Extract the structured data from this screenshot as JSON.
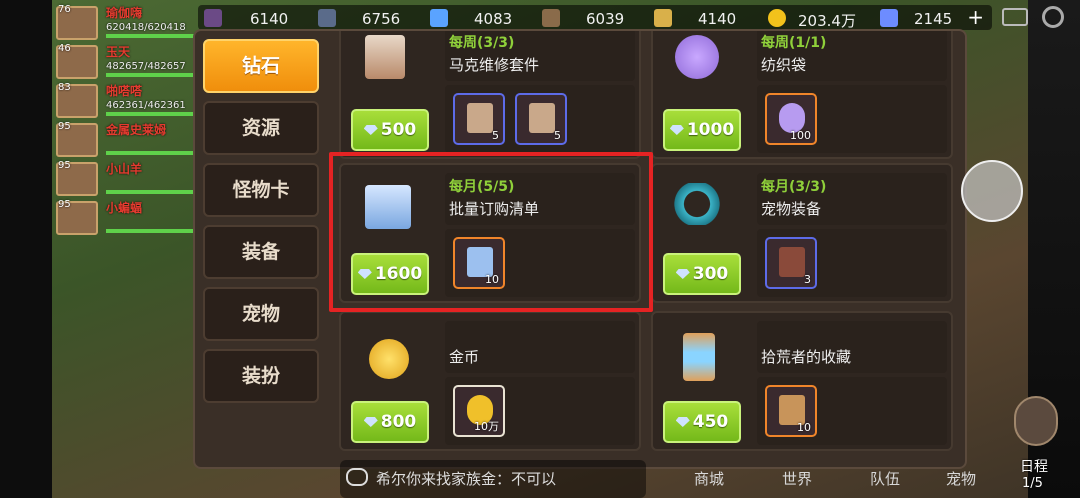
{
  "party": [
    {
      "level": "76",
      "name": "瑜伽嗨",
      "hp": "620418/620418",
      "hp_pct": 1.0
    },
    {
      "level": "46",
      "name": "玉天",
      "hp": "482657/482657",
      "hp_pct": 1.0
    },
    {
      "level": "83",
      "name": "啪嗒嗒",
      "hp": "462361/462361",
      "hp_pct": 1.0
    },
    {
      "level": "95",
      "name": "金属史莱姆",
      "hp": "",
      "hp_pct": 1.0
    },
    {
      "level": "95",
      "name": "小山羊",
      "hp": "",
      "hp_pct": 1.0
    },
    {
      "level": "95",
      "name": "小蝙蝠",
      "hp": "",
      "hp_pct": 1.0
    }
  ],
  "resources": [
    {
      "icon": "resource-icon-1",
      "value": "6140"
    },
    {
      "icon": "resource-icon-2",
      "value": "6756"
    },
    {
      "icon": "crystal-icon",
      "value": "4083"
    },
    {
      "icon": "resource-icon-4",
      "value": "6039"
    },
    {
      "icon": "wheat-icon",
      "value": "4140"
    },
    {
      "icon": "gold-coin-icon",
      "value": "203.4万"
    },
    {
      "icon": "diamond-icon",
      "value": "2145"
    }
  ],
  "categories": [
    {
      "label": "钻石",
      "active": true
    },
    {
      "label": "资源",
      "active": false
    },
    {
      "label": "怪物卡",
      "active": false
    },
    {
      "label": "装备",
      "active": false
    },
    {
      "label": "宠物",
      "active": false
    },
    {
      "label": "装扮",
      "active": false
    }
  ],
  "items": [
    {
      "limit": "每周(3/3)",
      "name": "马克维修套件",
      "price": "500",
      "icon": "repair-kit-icon",
      "rewards": [
        {
          "qty": "5",
          "icon": "repair-kit-icon",
          "border": "blue"
        },
        {
          "qty": "5",
          "icon": "repair-kit-icon",
          "border": "blue"
        }
      ]
    },
    {
      "limit": "每周(1/1)",
      "name": "纺织袋",
      "price": "1000",
      "icon": "yarn-ball-icon",
      "rewards": [
        {
          "qty": "100",
          "icon": "yarn-ball-icon",
          "border": "orange"
        }
      ]
    },
    {
      "limit": "每月(5/5)",
      "name": "批量订购清单",
      "price": "1600",
      "icon": "order-list-icon",
      "rewards": [
        {
          "qty": "10",
          "icon": "order-list-icon",
          "border": "orange"
        }
      ]
    },
    {
      "limit": "每月(3/3)",
      "name": "宠物装备",
      "price": "300",
      "icon": "pet-collar-icon",
      "rewards": [
        {
          "qty": "3",
          "icon": "mystery-chest-icon",
          "border": "blue"
        }
      ]
    },
    {
      "limit": "",
      "name": "金币",
      "price": "800",
      "icon": "gold-coin-icon",
      "rewards": [
        {
          "qty": "10万",
          "icon": "gold-coin-icon",
          "border": "white"
        }
      ]
    },
    {
      "limit": "",
      "name": "拾荒者的收藏",
      "price": "450",
      "icon": "hourglass-icon",
      "rewards": [
        {
          "qty": "10",
          "icon": "hourglass-icon",
          "border": "orange"
        }
      ]
    }
  ],
  "chat": {
    "text": "希尔你来找家族金：不可以"
  },
  "bottom_menu": [
    "商城",
    "世界",
    "队伍",
    "宠物"
  ],
  "schedule": {
    "label": "日程",
    "count": "1/5"
  },
  "colors": {
    "accent_orange": "#f5a11d",
    "price_green": "#8fd03a",
    "highlight_red": "#e52323",
    "panel_bg": "#3a2f27"
  }
}
